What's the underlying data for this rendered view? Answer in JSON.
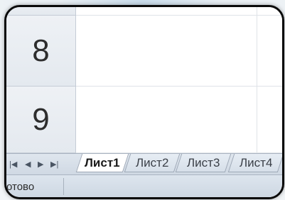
{
  "rows": [
    {
      "label": ""
    },
    {
      "label": "8"
    },
    {
      "label": "9"
    }
  ],
  "sheet_nav": {
    "first_icon": "first-sheet-icon",
    "prev_icon": "prev-sheet-icon",
    "next_icon": "next-sheet-icon",
    "last_icon": "last-sheet-icon"
  },
  "sheets": [
    {
      "label": "Лист1",
      "active": true
    },
    {
      "label": "Лист2",
      "active": false
    },
    {
      "label": "Лист3",
      "active": false
    },
    {
      "label": "Лист4",
      "active": false
    }
  ],
  "status": {
    "text": "отово"
  }
}
